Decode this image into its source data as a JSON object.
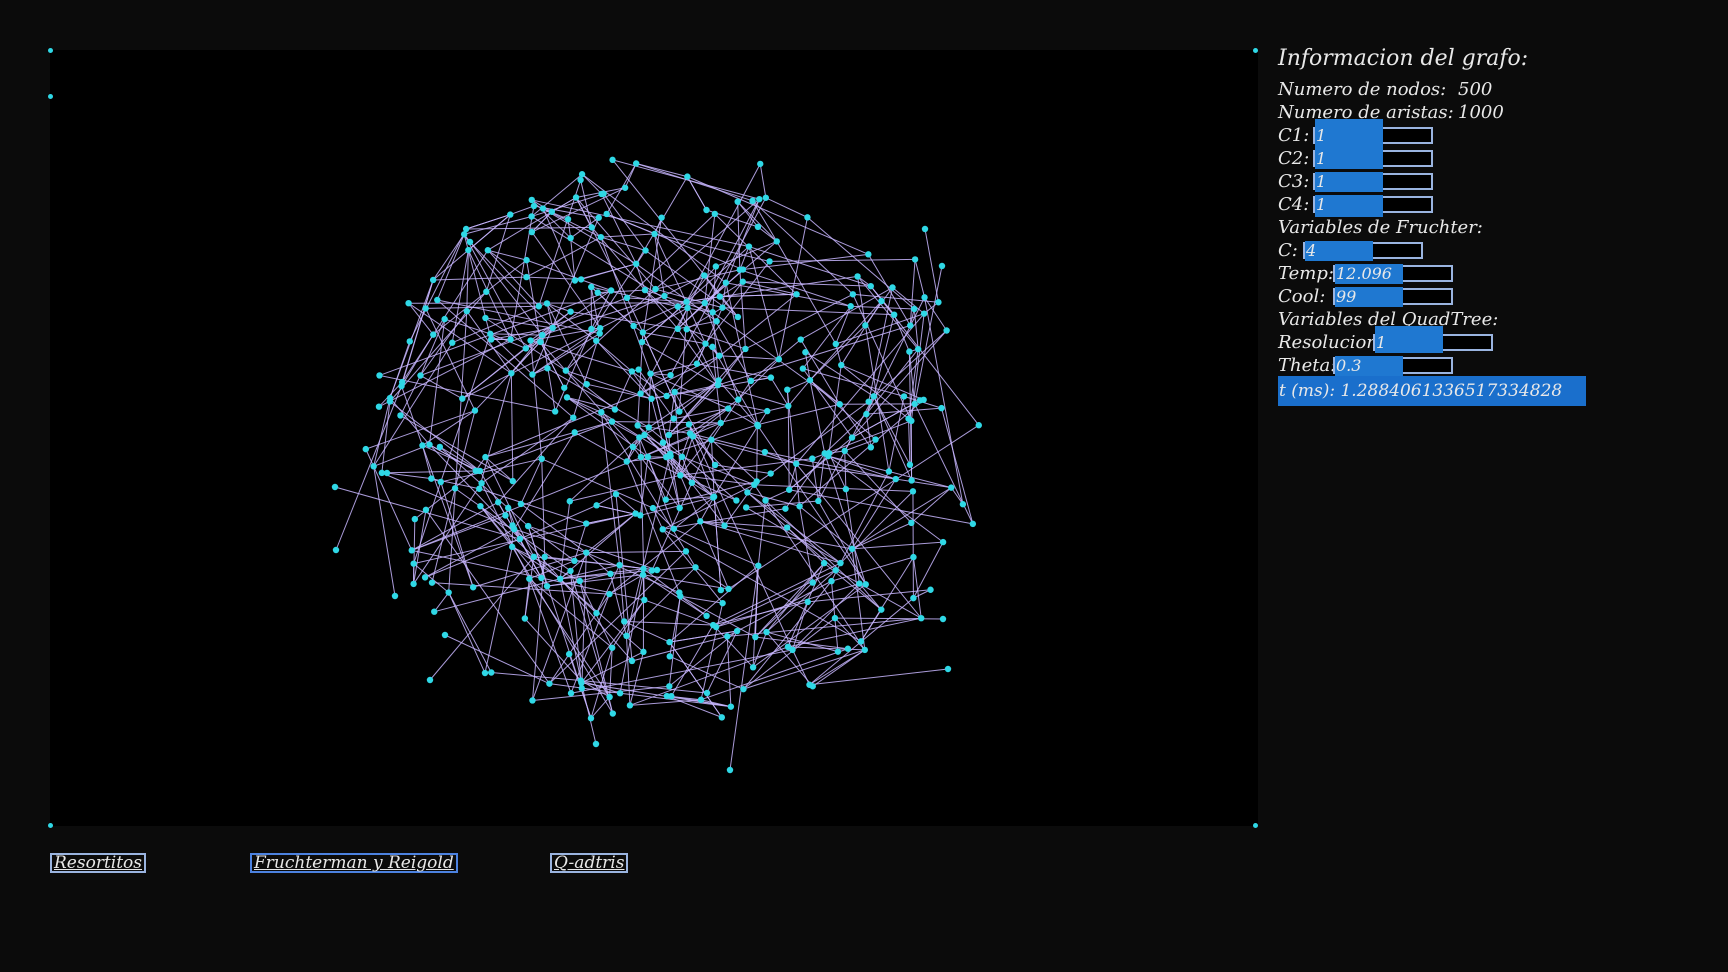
{
  "panel": {
    "title": "Informacion del grafo:",
    "nodes_label": "Numero de nodos:",
    "nodes_value": "500",
    "edges_label": "Numero de aristas:",
    "edges_value": "1000",
    "c1_label": "C1:",
    "c1_value": "1",
    "c2_label": "C2:",
    "c2_value": "1",
    "c3_label": "C3:",
    "c3_value": "1",
    "c4_label": "C4:",
    "c4_value": "1",
    "fruchter_header": "Variables de Fruchter:",
    "c_label": "C:",
    "c_value": "4",
    "temp_label": "Temp:",
    "temp_value": "12.096",
    "cool_label": "Cool:",
    "cool_value": "99",
    "quadtree_header": "Variables del QuadTree:",
    "resolution_label": "Resolucion:",
    "resolution_value": "1",
    "theta_label": "Theta:",
    "theta_value": "0.3",
    "time_label": "t (ms): 1.2884061336517334828"
  },
  "buttons": {
    "springs": "Resortitos",
    "fruchterman": "Fruchterman y Reigold",
    "quadtree": "Q-adtris"
  },
  "colors": {
    "node": "#2fd8e6",
    "edge": "#c8b6ff",
    "accent": "#1f78d1",
    "canvas_bg": "#000000",
    "page_bg": "#0b0b0b"
  }
}
